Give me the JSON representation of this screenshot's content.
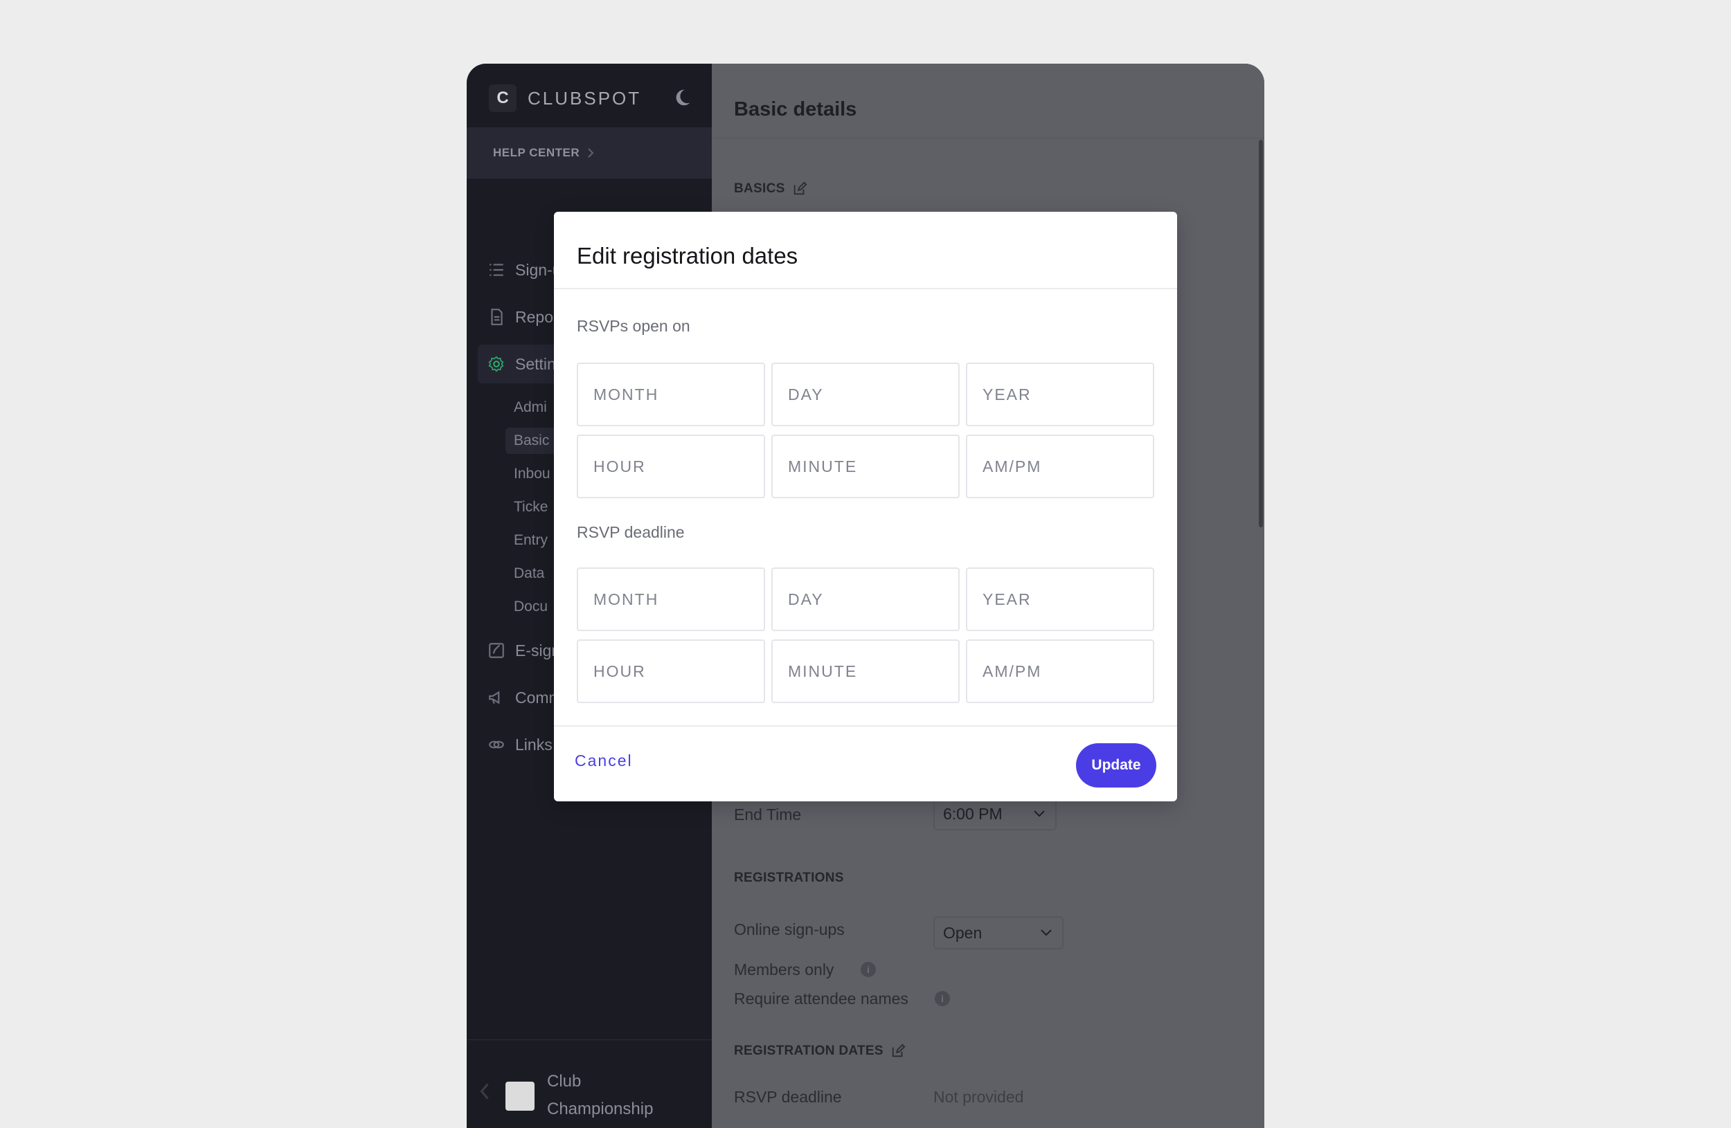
{
  "app": {
    "brand_letter": "C",
    "brand_name": "CLUBSPOT"
  },
  "sidebar": {
    "help_center": "HELP CENTER",
    "items": [
      {
        "label": "Sign-ups",
        "icon": "list-icon"
      },
      {
        "label": "Repo",
        "icon": "document-icon"
      },
      {
        "label": "Settin",
        "icon": "gear-icon"
      }
    ],
    "sub_items": [
      "Admi",
      "Basic",
      "Inbou",
      "Ticke",
      "Entry",
      "Data",
      "Docu"
    ],
    "lower_items": [
      {
        "label": "E-sign",
        "icon": "edit-icon"
      },
      {
        "label": "Comm",
        "icon": "megaphone-icon"
      },
      {
        "label": "Links",
        "icon": "link-icon"
      }
    ],
    "footer_label_line1": "Club",
    "footer_label_line2": "Championship"
  },
  "main": {
    "title": "Basic details",
    "basics_heading": "BASICS",
    "end_time_label": "End Time",
    "end_time_value": "6:00 PM",
    "registrations_heading": "REGISTRATIONS",
    "online_signups_label": "Online sign-ups",
    "online_signups_value": "Open",
    "members_only_label": "Members only",
    "require_names_label": "Require attendee names",
    "info_glyph": "i",
    "registration_dates_heading": "REGISTRATION DATES",
    "rsvp_deadline_label": "RSVP deadline",
    "rsvp_deadline_value": "Not provided",
    "toggle_color": "#1e8a4e"
  },
  "modal": {
    "title": "Edit registration dates",
    "open_label": "RSVPs open on",
    "deadline_label": "RSVP deadline",
    "placeholders": {
      "month": "MONTH",
      "day": "DAY",
      "year": "YEAR",
      "hour": "HOUR",
      "minute": "MINUTE",
      "ampm": "AM/PM"
    },
    "cancel": "Cancel",
    "update": "Update",
    "accent": "#4a3de6"
  }
}
